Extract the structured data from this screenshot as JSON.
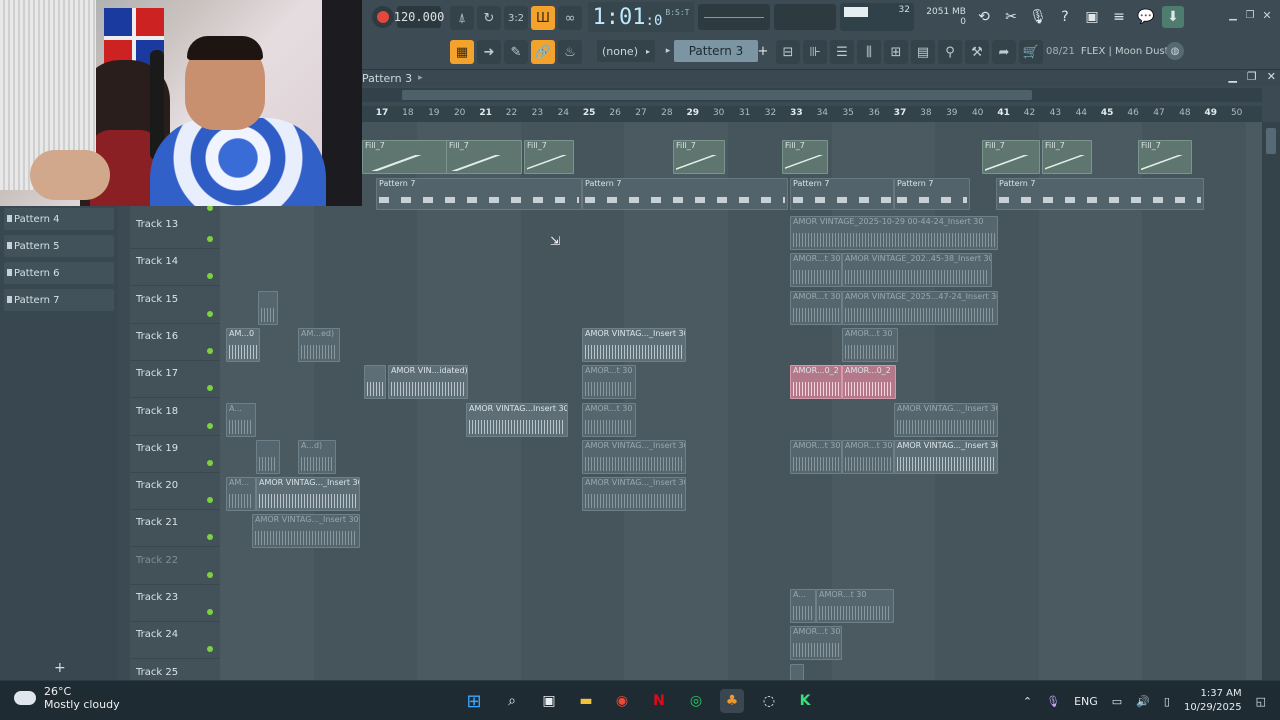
{
  "toolbar": {
    "tempo": "120.000",
    "time": "1:01",
    "time_sub": ":0",
    "time_unit": "B:S:T",
    "cpu_value": "32",
    "memory": "2051 MB",
    "memory_sub": "0",
    "pattern_selector": "Pattern 3",
    "pattern_add": "+",
    "snap_label": "(none)",
    "hint_count": "08/21",
    "hint_text": "FLEX | Moon Dust"
  },
  "playlist": {
    "title": "Pattern 3",
    "ruler": [
      "17",
      "18",
      "19",
      "20",
      "21",
      "22",
      "23",
      "24",
      "25",
      "26",
      "27",
      "28",
      "29",
      "30",
      "31",
      "32",
      "33",
      "34",
      "35",
      "36",
      "37",
      "38",
      "39",
      "40",
      "41",
      "42",
      "43",
      "44",
      "45",
      "46",
      "47",
      "48",
      "49",
      "50"
    ],
    "picker": [
      "Pattern 4",
      "Pattern 5",
      "Pattern 6",
      "Pattern 7"
    ],
    "picker_add": "+",
    "tracks": [
      "Track 13",
      "Track 14",
      "Track 15",
      "Track 16",
      "Track 17",
      "Track 18",
      "Track 19",
      "Track 20",
      "Track 21",
      "Track 22",
      "Track 23",
      "Track 24",
      "Track 25"
    ],
    "top_clips": {
      "fill": "Fill_7",
      "pattern": "Pattern 7"
    },
    "clips": {
      "c13a": "AMOR VINTAGE_2025-10-29 00-44-24_Insert 30",
      "c14a": "AMOR...t 30",
      "c14b": "AMOR VINTAGE_202..45-38_Insert 30",
      "c15a": "AMOR...t 30",
      "c15b": "AMOR VINTAGE_2025...47-24_Insert 30",
      "c16a": "AM...0",
      "c16b": "AM...ed)",
      "c16c": "AMOR VINTAG..._Insert 30",
      "c16d": "AMOR...t 30",
      "c17a": "AMOR VIN...idated)",
      "c17b": "AMOR...t 30",
      "c17c": "AMOR...0_2",
      "c17d": "AMOR...0_2",
      "c18a": "A...",
      "c18b": "AMOR VINTAG...Insert 30",
      "c18c": "AMOR...t 30",
      "c18d": "AMOR VINTAG..._Insert 30",
      "c19a": "A...d)",
      "c19b": "AMOR VINTAG..._Insert 30",
      "c19c": "AMOR...t 30",
      "c19d": "AMOR...t 30",
      "c19e": "AMOR VINTAG..._Insert 30",
      "c20a": "AM...",
      "c20b": "AMOR VINTAG..._Insert 30",
      "c20c": "AMOR VINTAG..._Insert 30",
      "c21a": "AMOR VINTAG..._Insert 30",
      "c23a": "A...",
      "c23b": "AMOR...t 30",
      "c24a": "AMOR...t 30"
    }
  },
  "taskbar": {
    "temperature": "26°C",
    "weather": "Mostly cloudy",
    "lang": "ENG",
    "time": "1:37 AM",
    "date": "10/29/2025"
  }
}
